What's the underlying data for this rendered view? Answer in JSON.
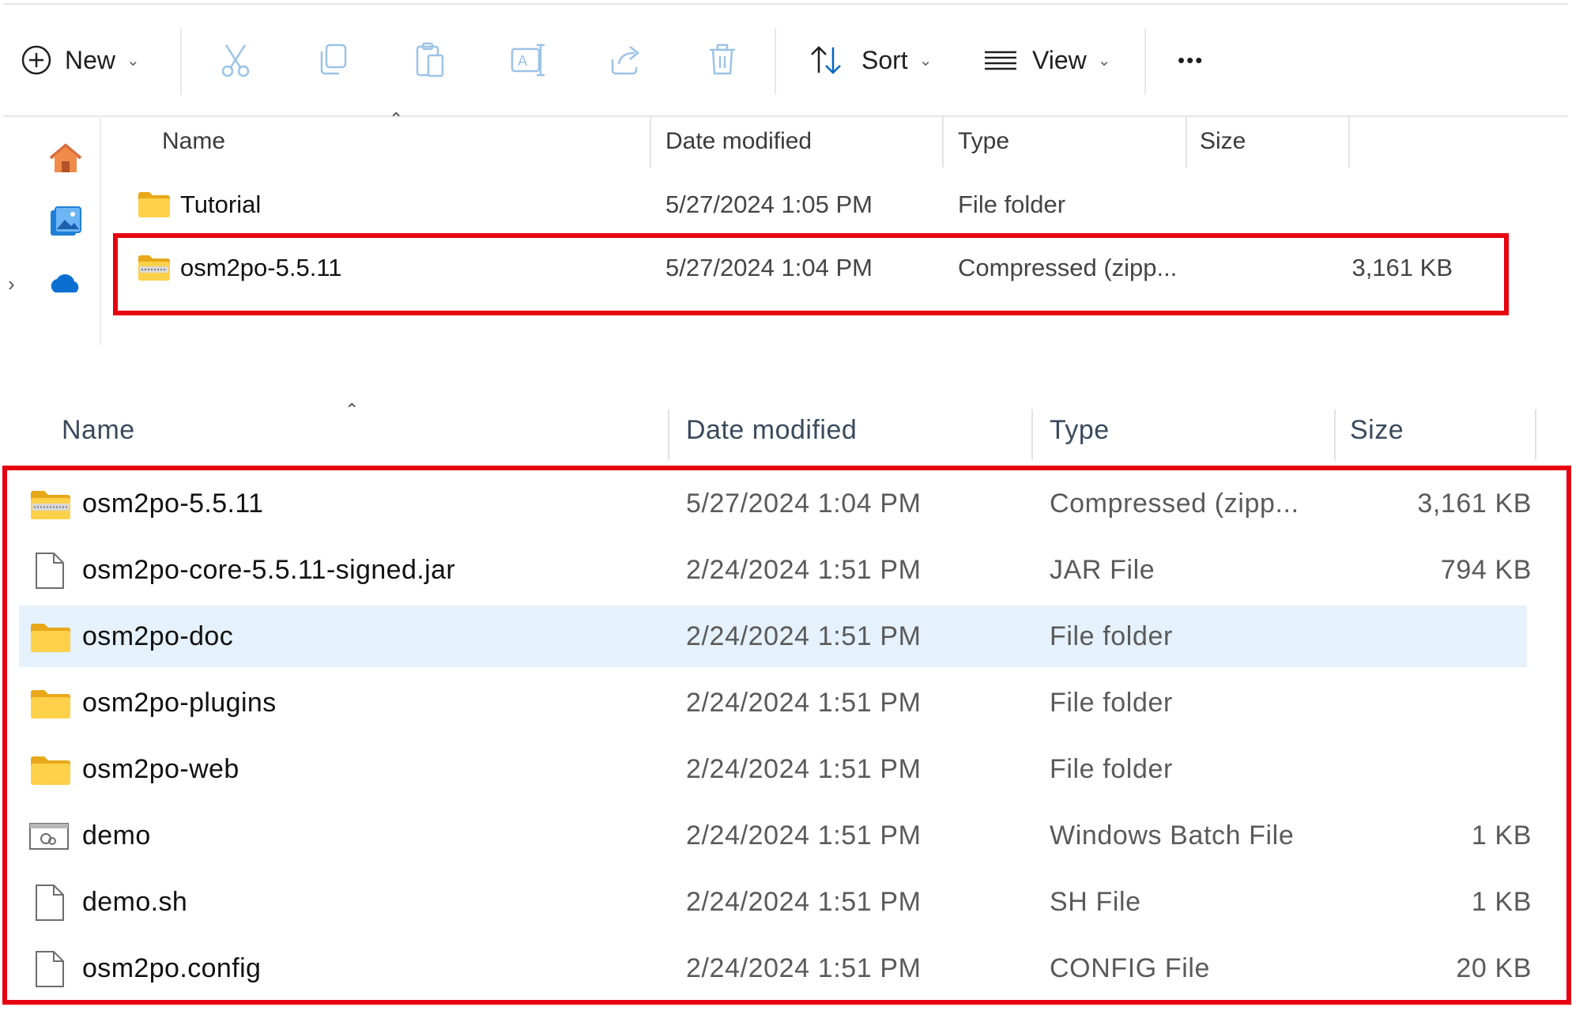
{
  "toolbar": {
    "new_label": "New",
    "sort_label": "Sort",
    "view_label": "View",
    "more_label": "•••"
  },
  "panel1": {
    "columns": {
      "name": "Name",
      "date": "Date modified",
      "type": "Type",
      "size": "Size"
    },
    "rows": [
      {
        "icon": "folder-icon",
        "name": "Tutorial",
        "date": "5/27/2024 1:05 PM",
        "type": "File folder",
        "size": ""
      },
      {
        "icon": "zip-folder-icon",
        "name": "osm2po-5.5.11",
        "date": "5/27/2024 1:04 PM",
        "type": "Compressed (zipp...",
        "size": "3,161 KB"
      }
    ]
  },
  "panel2": {
    "columns": {
      "name": "Name",
      "date": "Date modified",
      "type": "Type",
      "size": "Size"
    },
    "rows": [
      {
        "icon": "zip-folder-icon",
        "name": "osm2po-5.5.11",
        "date": "5/27/2024 1:04 PM",
        "type": "Compressed (zipp...",
        "size": "3,161 KB"
      },
      {
        "icon": "file-icon",
        "name": "osm2po-core-5.5.11-signed.jar",
        "date": "2/24/2024 1:51 PM",
        "type": "JAR File",
        "size": "794 KB"
      },
      {
        "icon": "folder-icon",
        "name": "osm2po-doc",
        "date": "2/24/2024 1:51 PM",
        "type": "File folder",
        "size": ""
      },
      {
        "icon": "folder-icon",
        "name": "osm2po-plugins",
        "date": "2/24/2024 1:51 PM",
        "type": "File folder",
        "size": ""
      },
      {
        "icon": "folder-icon",
        "name": "osm2po-web",
        "date": "2/24/2024 1:51 PM",
        "type": "File folder",
        "size": ""
      },
      {
        "icon": "batch-file-icon",
        "name": "demo",
        "date": "2/24/2024 1:51 PM",
        "type": "Windows Batch File",
        "size": "1 KB"
      },
      {
        "icon": "file-icon",
        "name": "demo.sh",
        "date": "2/24/2024 1:51 PM",
        "type": "SH File",
        "size": "1 KB"
      },
      {
        "icon": "file-icon",
        "name": "osm2po.config",
        "date": "2/24/2024 1:51 PM",
        "type": "CONFIG File",
        "size": "20 KB"
      }
    ]
  },
  "colors": {
    "highlight_box": "#e60010",
    "selected_row": "#e5f1fb",
    "accent": "#0067c0",
    "folder": "#f7c948"
  }
}
